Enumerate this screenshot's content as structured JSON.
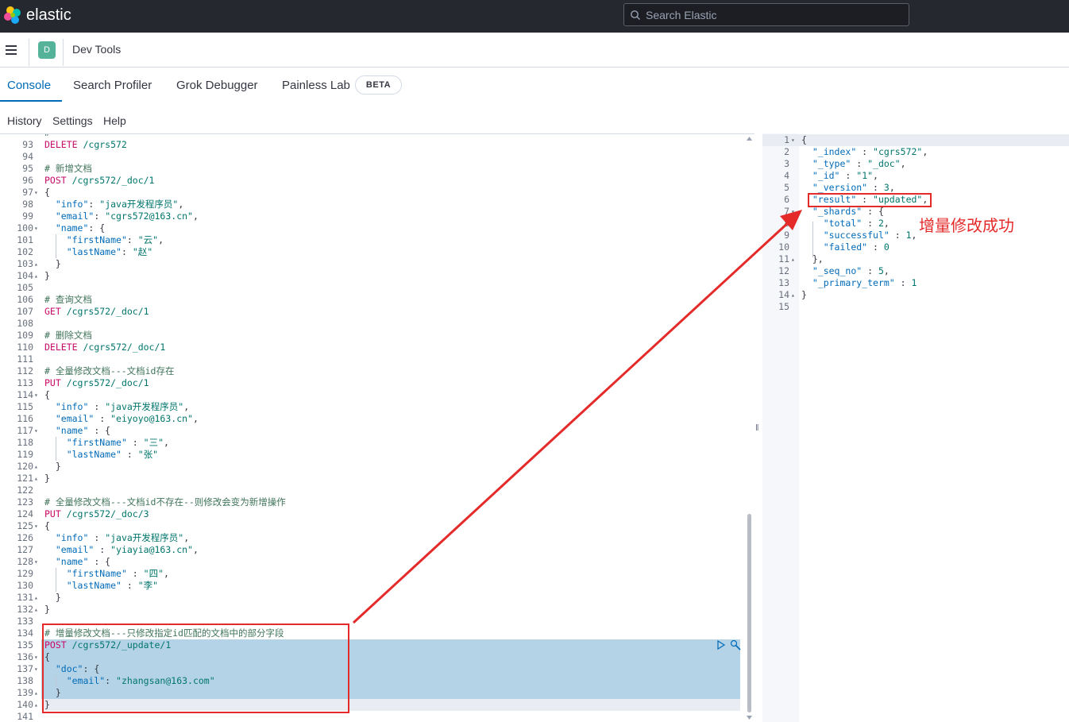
{
  "app": {
    "brand": "elastic",
    "search_placeholder": "Search Elastic",
    "avatar_letter": "D",
    "breadcrumb": "Dev Tools"
  },
  "tabs": [
    {
      "label": "Console",
      "active": true
    },
    {
      "label": "Search Profiler"
    },
    {
      "label": "Grok Debugger"
    },
    {
      "label": "Painless Lab"
    }
  ],
  "beta_badge": "BETA",
  "subnav": [
    "History",
    "Settings",
    "Help"
  ],
  "editor": {
    "lines": [
      {
        "n": "93",
        "fold": "",
        "parts": [
          [
            "m",
            "DELETE"
          ],
          [
            "u",
            " /cgrs572"
          ]
        ]
      },
      {
        "n": "94",
        "fold": "",
        "parts": []
      },
      {
        "n": "95",
        "fold": "",
        "parts": [
          [
            "c",
            "# 新增文档"
          ]
        ]
      },
      {
        "n": "96",
        "fold": "",
        "parts": [
          [
            "m",
            "POST"
          ],
          [
            "u",
            " /cgrs572/_doc/1"
          ]
        ]
      },
      {
        "n": "97",
        "fold": "▾",
        "parts": [
          [
            "p",
            "{"
          ]
        ]
      },
      {
        "n": "98",
        "fold": "",
        "parts": [
          [
            "p",
            "  "
          ],
          [
            "k",
            "\"info\""
          ],
          [
            "p",
            ": "
          ],
          [
            "s",
            "\"java开发程序员\""
          ],
          [
            "p",
            ","
          ]
        ]
      },
      {
        "n": "99",
        "fold": "",
        "parts": [
          [
            "p",
            "  "
          ],
          [
            "k",
            "\"email\""
          ],
          [
            "p",
            ": "
          ],
          [
            "s",
            "\"cgrs572@163.cn\""
          ],
          [
            "p",
            ","
          ]
        ]
      },
      {
        "n": "100",
        "fold": "▾",
        "parts": [
          [
            "p",
            "  "
          ],
          [
            "k",
            "\"name\""
          ],
          [
            "p",
            ": {"
          ]
        ]
      },
      {
        "n": "101",
        "fold": "",
        "parts": [
          [
            "p",
            "    "
          ],
          [
            "k",
            "\"firstName\""
          ],
          [
            "p",
            ": "
          ],
          [
            "s",
            "\"云\""
          ],
          [
            "p",
            ","
          ]
        ]
      },
      {
        "n": "102",
        "fold": "",
        "parts": [
          [
            "p",
            "    "
          ],
          [
            "k",
            "\"lastName\""
          ],
          [
            "p",
            ": "
          ],
          [
            "s",
            "\"赵\""
          ]
        ]
      },
      {
        "n": "103",
        "fold": "▴",
        "parts": [
          [
            "p",
            "  }"
          ]
        ]
      },
      {
        "n": "104",
        "fold": "▴",
        "parts": [
          [
            "p",
            "}"
          ]
        ]
      },
      {
        "n": "105",
        "fold": "",
        "parts": []
      },
      {
        "n": "106",
        "fold": "",
        "parts": [
          [
            "c",
            "# 查询文档"
          ]
        ]
      },
      {
        "n": "107",
        "fold": "",
        "parts": [
          [
            "m",
            "GET"
          ],
          [
            "u",
            " /cgrs572/_doc/1"
          ]
        ]
      },
      {
        "n": "108",
        "fold": "",
        "parts": []
      },
      {
        "n": "109",
        "fold": "",
        "parts": [
          [
            "c",
            "# 删除文档"
          ]
        ]
      },
      {
        "n": "110",
        "fold": "",
        "parts": [
          [
            "m",
            "DELETE"
          ],
          [
            "u",
            " /cgrs572/_doc/1"
          ]
        ]
      },
      {
        "n": "111",
        "fold": "",
        "parts": []
      },
      {
        "n": "112",
        "fold": "",
        "parts": [
          [
            "c",
            "# 全量修改文档---文档id存在"
          ]
        ]
      },
      {
        "n": "113",
        "fold": "",
        "parts": [
          [
            "m",
            "PUT"
          ],
          [
            "u",
            " /cgrs572/_doc/1"
          ]
        ]
      },
      {
        "n": "114",
        "fold": "▾",
        "parts": [
          [
            "p",
            "{"
          ]
        ]
      },
      {
        "n": "115",
        "fold": "",
        "parts": [
          [
            "p",
            "  "
          ],
          [
            "k",
            "\"info\""
          ],
          [
            "p",
            " : "
          ],
          [
            "s",
            "\"java开发程序员\""
          ],
          [
            "p",
            ","
          ]
        ]
      },
      {
        "n": "116",
        "fold": "",
        "parts": [
          [
            "p",
            "  "
          ],
          [
            "k",
            "\"email\""
          ],
          [
            "p",
            " : "
          ],
          [
            "s",
            "\"eiyoyo@163.cn\""
          ],
          [
            "p",
            ","
          ]
        ]
      },
      {
        "n": "117",
        "fold": "▾",
        "parts": [
          [
            "p",
            "  "
          ],
          [
            "k",
            "\"name\""
          ],
          [
            "p",
            " : {"
          ]
        ]
      },
      {
        "n": "118",
        "fold": "",
        "parts": [
          [
            "p",
            "    "
          ],
          [
            "k",
            "\"firstName\""
          ],
          [
            "p",
            " : "
          ],
          [
            "s",
            "\"三\""
          ],
          [
            "p",
            ","
          ]
        ]
      },
      {
        "n": "119",
        "fold": "",
        "parts": [
          [
            "p",
            "    "
          ],
          [
            "k",
            "\"lastName\""
          ],
          [
            "p",
            " : "
          ],
          [
            "s",
            "\"张\""
          ]
        ]
      },
      {
        "n": "120",
        "fold": "▴",
        "parts": [
          [
            "p",
            "  }"
          ]
        ]
      },
      {
        "n": "121",
        "fold": "▴",
        "parts": [
          [
            "p",
            "}"
          ]
        ]
      },
      {
        "n": "122",
        "fold": "",
        "parts": []
      },
      {
        "n": "123",
        "fold": "",
        "parts": [
          [
            "c",
            "# 全量修改文档---文档id不存在--则修改会变为新增操作"
          ]
        ]
      },
      {
        "n": "124",
        "fold": "",
        "parts": [
          [
            "m",
            "PUT"
          ],
          [
            "u",
            " /cgrs572/_doc/3"
          ]
        ]
      },
      {
        "n": "125",
        "fold": "▾",
        "parts": [
          [
            "p",
            "{"
          ]
        ]
      },
      {
        "n": "126",
        "fold": "",
        "parts": [
          [
            "p",
            "  "
          ],
          [
            "k",
            "\"info\""
          ],
          [
            "p",
            " : "
          ],
          [
            "s",
            "\"java开发程序员\""
          ],
          [
            "p",
            ","
          ]
        ]
      },
      {
        "n": "127",
        "fold": "",
        "parts": [
          [
            "p",
            "  "
          ],
          [
            "k",
            "\"email\""
          ],
          [
            "p",
            " : "
          ],
          [
            "s",
            "\"yiayia@163.cn\""
          ],
          [
            "p",
            ","
          ]
        ]
      },
      {
        "n": "128",
        "fold": "▾",
        "parts": [
          [
            "p",
            "  "
          ],
          [
            "k",
            "\"name\""
          ],
          [
            "p",
            " : {"
          ]
        ]
      },
      {
        "n": "129",
        "fold": "",
        "parts": [
          [
            "p",
            "    "
          ],
          [
            "k",
            "\"firstName\""
          ],
          [
            "p",
            " : "
          ],
          [
            "s",
            "\"四\""
          ],
          [
            "p",
            ","
          ]
        ]
      },
      {
        "n": "130",
        "fold": "",
        "parts": [
          [
            "p",
            "    "
          ],
          [
            "k",
            "\"lastName\""
          ],
          [
            "p",
            " : "
          ],
          [
            "s",
            "\"李\""
          ]
        ]
      },
      {
        "n": "131",
        "fold": "▴",
        "parts": [
          [
            "p",
            "  }"
          ]
        ]
      },
      {
        "n": "132",
        "fold": "▴",
        "parts": [
          [
            "p",
            "}"
          ]
        ]
      },
      {
        "n": "133",
        "fold": "",
        "parts": []
      },
      {
        "n": "134",
        "fold": "",
        "parts": [
          [
            "c",
            "# 增量修改文档---只修改指定id匹配的文档中的部分字段"
          ]
        ]
      },
      {
        "n": "135",
        "fold": "",
        "parts": [
          [
            "m",
            "POST"
          ],
          [
            "u",
            " /cgrs572/_update/1"
          ]
        ]
      },
      {
        "n": "136",
        "fold": "▾",
        "parts": [
          [
            "p",
            "{"
          ]
        ]
      },
      {
        "n": "137",
        "fold": "▾",
        "parts": [
          [
            "p",
            "  "
          ],
          [
            "k",
            "\"doc\""
          ],
          [
            "p",
            ": {"
          ]
        ]
      },
      {
        "n": "138",
        "fold": "",
        "parts": [
          [
            "p",
            "    "
          ],
          [
            "k",
            "\"email\""
          ],
          [
            "p",
            ": "
          ],
          [
            "s",
            "\"zhangsan@163.com\""
          ]
        ]
      },
      {
        "n": "139",
        "fold": "▴",
        "parts": [
          [
            "p",
            "  }"
          ]
        ]
      },
      {
        "n": "140",
        "fold": "▴",
        "parts": [
          [
            "p",
            "}"
          ]
        ]
      },
      {
        "n": "141",
        "fold": "",
        "parts": []
      }
    ]
  },
  "response": {
    "lines": [
      {
        "n": "1",
        "fold": "▾",
        "parts": [
          [
            "p",
            "{"
          ]
        ]
      },
      {
        "n": "2",
        "fold": "",
        "parts": [
          [
            "p",
            "  "
          ],
          [
            "k",
            "\"_index\""
          ],
          [
            "p",
            " : "
          ],
          [
            "s",
            "\"cgrs572\""
          ],
          [
            "p",
            ","
          ]
        ]
      },
      {
        "n": "3",
        "fold": "",
        "parts": [
          [
            "p",
            "  "
          ],
          [
            "k",
            "\"_type\""
          ],
          [
            "p",
            " : "
          ],
          [
            "s",
            "\"_doc\""
          ],
          [
            "p",
            ","
          ]
        ]
      },
      {
        "n": "4",
        "fold": "",
        "parts": [
          [
            "p",
            "  "
          ],
          [
            "k",
            "\"_id\""
          ],
          [
            "p",
            " : "
          ],
          [
            "s",
            "\"1\""
          ],
          [
            "p",
            ","
          ]
        ]
      },
      {
        "n": "5",
        "fold": "",
        "parts": [
          [
            "p",
            "  "
          ],
          [
            "k",
            "\"_version\""
          ],
          [
            "p",
            " : "
          ],
          [
            "s",
            "3"
          ],
          [
            "p",
            ","
          ]
        ]
      },
      {
        "n": "6",
        "fold": "",
        "parts": [
          [
            "p",
            "  "
          ],
          [
            "k",
            "\"result\""
          ],
          [
            "p",
            " : "
          ],
          [
            "s",
            "\"updated\""
          ],
          [
            "p",
            ","
          ]
        ]
      },
      {
        "n": "7",
        "fold": "▾",
        "parts": [
          [
            "p",
            "  "
          ],
          [
            "k",
            "\"_shards\""
          ],
          [
            "p",
            " : {"
          ]
        ]
      },
      {
        "n": "8",
        "fold": "",
        "parts": [
          [
            "p",
            "    "
          ],
          [
            "k",
            "\"total\""
          ],
          [
            "p",
            " : "
          ],
          [
            "s",
            "2"
          ],
          [
            "p",
            ","
          ]
        ]
      },
      {
        "n": "9",
        "fold": "",
        "parts": [
          [
            "p",
            "    "
          ],
          [
            "k",
            "\"successful\""
          ],
          [
            "p",
            " : "
          ],
          [
            "s",
            "1"
          ],
          [
            "p",
            ","
          ]
        ]
      },
      {
        "n": "10",
        "fold": "",
        "parts": [
          [
            "p",
            "    "
          ],
          [
            "k",
            "\"failed\""
          ],
          [
            "p",
            " : "
          ],
          [
            "s",
            "0"
          ]
        ]
      },
      {
        "n": "11",
        "fold": "▴",
        "parts": [
          [
            "p",
            "  },"
          ]
        ]
      },
      {
        "n": "12",
        "fold": "",
        "parts": [
          [
            "p",
            "  "
          ],
          [
            "k",
            "\"_seq_no\""
          ],
          [
            "p",
            " : "
          ],
          [
            "s",
            "5"
          ],
          [
            "p",
            ","
          ]
        ]
      },
      {
        "n": "13",
        "fold": "",
        "parts": [
          [
            "p",
            "  "
          ],
          [
            "k",
            "\"_primary_term\""
          ],
          [
            "p",
            " : "
          ],
          [
            "s",
            "1"
          ]
        ]
      },
      {
        "n": "14",
        "fold": "▴",
        "parts": [
          [
            "p",
            "}"
          ]
        ]
      },
      {
        "n": "15",
        "fold": "",
        "parts": []
      }
    ]
  },
  "annotation": {
    "label": "增量修改成功",
    "color": "#e52a2a"
  },
  "colors": {
    "topbar": "#25282f",
    "accent": "#006bb8",
    "selection": "#b5d3e6"
  }
}
